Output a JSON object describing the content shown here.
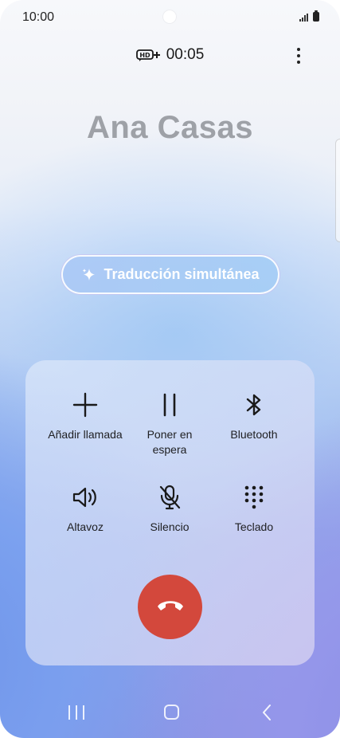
{
  "status_bar": {
    "time": "10:00"
  },
  "call": {
    "hd_badge": "HD+",
    "timer": "00:05",
    "caller_name": "Ana Casas"
  },
  "translation": {
    "label": "Traducción simultánea",
    "accent": "#ffffff"
  },
  "controls": [
    {
      "label": "Añadir llamada",
      "icon": "plus-icon"
    },
    {
      "label": "Poner en espera",
      "icon": "pause-icon"
    },
    {
      "label": "Bluetooth",
      "icon": "bluetooth-icon"
    },
    {
      "label": "Altavoz",
      "icon": "speaker-icon"
    },
    {
      "label": "Silencio",
      "icon": "mic-off-icon"
    },
    {
      "label": "Teclado",
      "icon": "keypad-icon"
    }
  ],
  "end_call": {
    "icon": "phone-hangup-icon",
    "color": "#d3483c"
  },
  "nav": {
    "recents_icon": "recents-icon",
    "home_icon": "home-icon",
    "back_icon": "back-icon"
  }
}
